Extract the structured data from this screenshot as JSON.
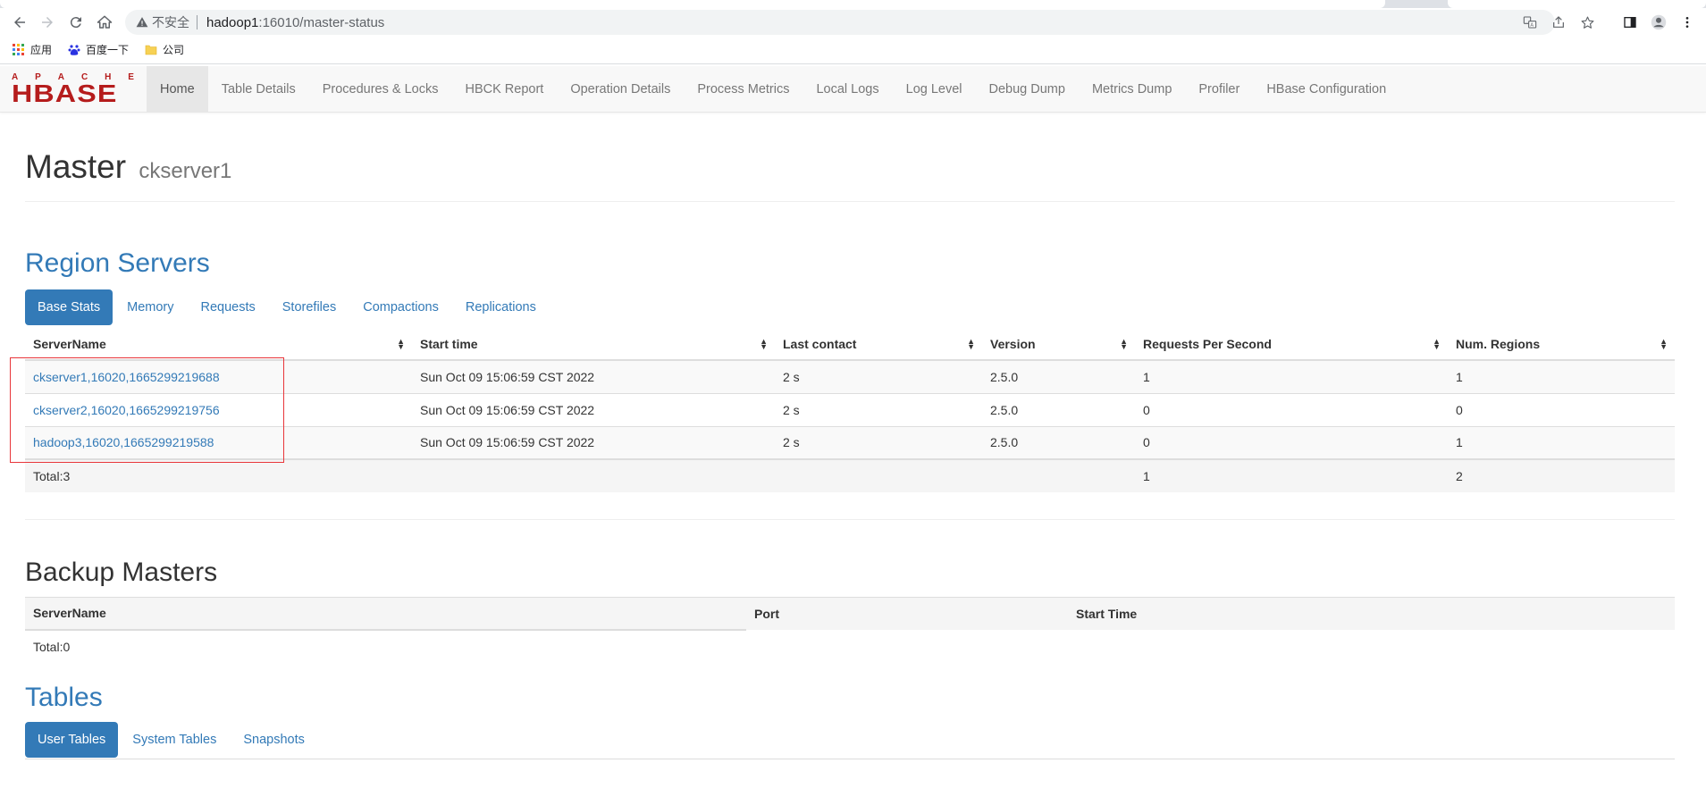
{
  "browser": {
    "security_label": "不安全",
    "url_host": "hadoop1",
    "url_path": ":16010/master-status",
    "icons": [
      "back-icon",
      "forward-icon",
      "reload-icon",
      "home-icon",
      "warning-icon",
      "translate-icon",
      "share-icon",
      "star-icon",
      "sidepanel-icon",
      "profile-icon",
      "menu-icon"
    ]
  },
  "bookmarks": [
    {
      "label": "应用",
      "icon": "apps-icon"
    },
    {
      "label": "百度一下",
      "icon": "baidu-icon"
    },
    {
      "label": "公司",
      "icon": "folder-icon"
    }
  ],
  "logo": {
    "top": [
      "A",
      "P",
      "A",
      "C",
      "H",
      "E"
    ],
    "main": "HBASE"
  },
  "nav": [
    {
      "label": "Home",
      "active": true
    },
    {
      "label": "Table Details"
    },
    {
      "label": "Procedures & Locks"
    },
    {
      "label": "HBCK Report"
    },
    {
      "label": "Operation Details"
    },
    {
      "label": "Process Metrics"
    },
    {
      "label": "Local Logs"
    },
    {
      "label": "Log Level"
    },
    {
      "label": "Debug Dump"
    },
    {
      "label": "Metrics Dump"
    },
    {
      "label": "Profiler"
    },
    {
      "label": "HBase Configuration"
    }
  ],
  "header": {
    "title": "Master",
    "subtitle": "ckserver1"
  },
  "region_servers": {
    "title": "Region Servers",
    "tabs": [
      "Base Stats",
      "Memory",
      "Requests",
      "Storefiles",
      "Compactions",
      "Replications"
    ],
    "columns": [
      "ServerName",
      "Start time",
      "Last contact",
      "Version",
      "Requests Per Second",
      "Num. Regions"
    ],
    "rows": [
      [
        "ckserver1,16020,1665299219688",
        "Sun Oct 09 15:06:59 CST 2022",
        "2 s",
        "2.5.0",
        "1",
        "1"
      ],
      [
        "ckserver2,16020,1665299219756",
        "Sun Oct 09 15:06:59 CST 2022",
        "2 s",
        "2.5.0",
        "0",
        "0"
      ],
      [
        "hadoop3,16020,1665299219588",
        "Sun Oct 09 15:06:59 CST 2022",
        "2 s",
        "2.5.0",
        "0",
        "1"
      ]
    ],
    "total": {
      "label": "Total:3",
      "requests": "1",
      "regions": "2"
    }
  },
  "backup_masters": {
    "title": "Backup Masters",
    "columns": [
      "ServerName",
      "Port",
      "Start Time"
    ],
    "total": "Total:0"
  },
  "tables": {
    "title": "Tables",
    "tabs": [
      "User Tables",
      "System Tables",
      "Snapshots"
    ]
  },
  "colors": {
    "link": "#337ab7",
    "logo": "#b51c1c",
    "highlight": "#e8363a"
  }
}
